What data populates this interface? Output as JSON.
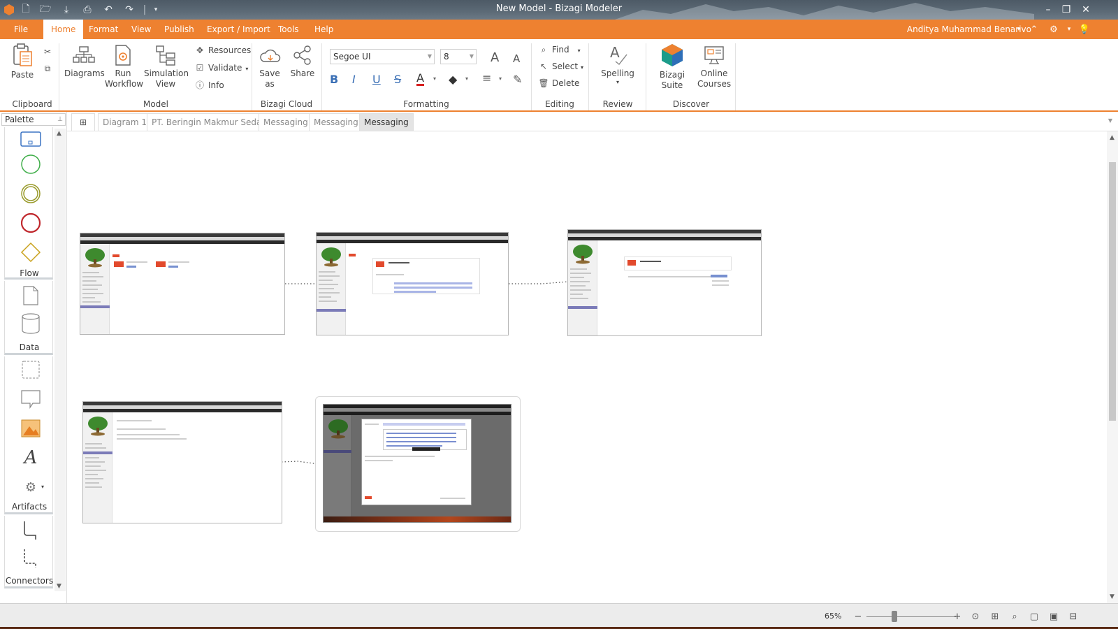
{
  "window": {
    "title": "New Model - Bizagi Modeler",
    "brand_color": "#ee8130"
  },
  "menu": {
    "tabs": [
      "File",
      "Home",
      "Format",
      "View",
      "Publish",
      "Export / Import",
      "Tools",
      "Help"
    ],
    "active_tab": "Home",
    "user": "Anditya Muhammad Benarivo"
  },
  "ribbon": {
    "clipboard": {
      "paste": "Paste",
      "label": "Clipboard"
    },
    "model": {
      "diagrams": "Diagrams",
      "run_workflow": "Run Workflow",
      "simulation_view": "Simulation View",
      "resources": "Resources",
      "validate": "Validate",
      "info": "Info",
      "label": "Model"
    },
    "cloud": {
      "save_as": "Save as",
      "share": "Share",
      "label": "Bizagi Cloud"
    },
    "formatting": {
      "font": "Segoe UI",
      "size": "8",
      "bold": "B",
      "italic": "I",
      "underline": "U",
      "strike": "S",
      "label": "Formatting"
    },
    "editing": {
      "find": "Find",
      "select": "Select",
      "delete": "Delete",
      "label": "Editing"
    },
    "review": {
      "spelling": "Spelling",
      "label": "Review"
    },
    "discover": {
      "suite": "Bizagi Suite",
      "courses": "Online Courses",
      "label": "Discover"
    }
  },
  "palette": {
    "header": "Palette",
    "sections": [
      "Flow",
      "Data",
      "Artifacts",
      "Connectors"
    ]
  },
  "doc_tabs": [
    "Diagram 1",
    "PT. Beringin Makmur Sedaya",
    "Messaging",
    "Messaging",
    "Messaging"
  ],
  "active_doc_tab": 4,
  "status": {
    "zoom": "65%"
  },
  "icons": {
    "paste": "paste-icon",
    "cut": "cut-icon",
    "copy": "copy-icon",
    "find": "magnifier-icon",
    "select": "cursor-icon",
    "delete": "trash-icon",
    "settings": "gear-icon",
    "help": "lightbulb-icon"
  }
}
